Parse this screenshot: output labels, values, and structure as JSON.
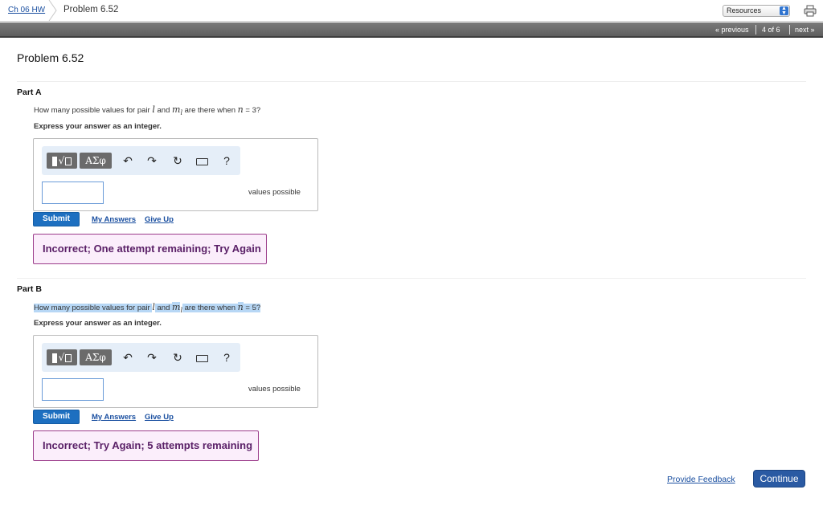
{
  "header": {
    "breadcrumb_link": "Ch 06 HW",
    "breadcrumb_current": "Problem 6.52",
    "resources_label": "Resources"
  },
  "nav": {
    "previous": "« previous",
    "position": "4 of 6",
    "next": "next »"
  },
  "page_title": "Problem 6.52",
  "parts": [
    {
      "label": "Part A",
      "question_prefix": "How many possible values for pair ",
      "var_l": "l",
      "and": " and ",
      "var_ml": "m",
      "var_ml_sub": "l",
      "mid": " are there when ",
      "var_n": "n",
      "suffix": " = 3?",
      "express": "Express your answer as an integer.",
      "units": "values possible",
      "input_value": "",
      "submit": "Submit",
      "my_answers": "My Answers",
      "give_up": "Give Up",
      "feedback": "Incorrect; One attempt remaining; Try Again"
    },
    {
      "label": "Part B",
      "question_prefix": "How many possible values for pair ",
      "var_l": "l",
      "and": " and ",
      "var_ml": "m",
      "var_ml_sub": "l",
      "mid": " are there when ",
      "var_n": "n",
      "suffix": " = 5?",
      "express": "Express your answer as an integer.",
      "units": "values possible",
      "input_value": "",
      "submit": "Submit",
      "my_answers": "My Answers",
      "give_up": "Give Up",
      "feedback": "Incorrect; Try Again; 5 attempts remaining"
    }
  ],
  "toolbar": {
    "templates_label": "√",
    "greek_label": "ΑΣφ",
    "help_label": "?"
  },
  "footer": {
    "provide_feedback": "Provide Feedback",
    "continue": "Continue"
  },
  "colors": {
    "accent": "#1d6fc0",
    "feedback_border": "#9b3c8a",
    "feedback_bg": "#fbeefb",
    "highlight": "#b7d7f5"
  }
}
